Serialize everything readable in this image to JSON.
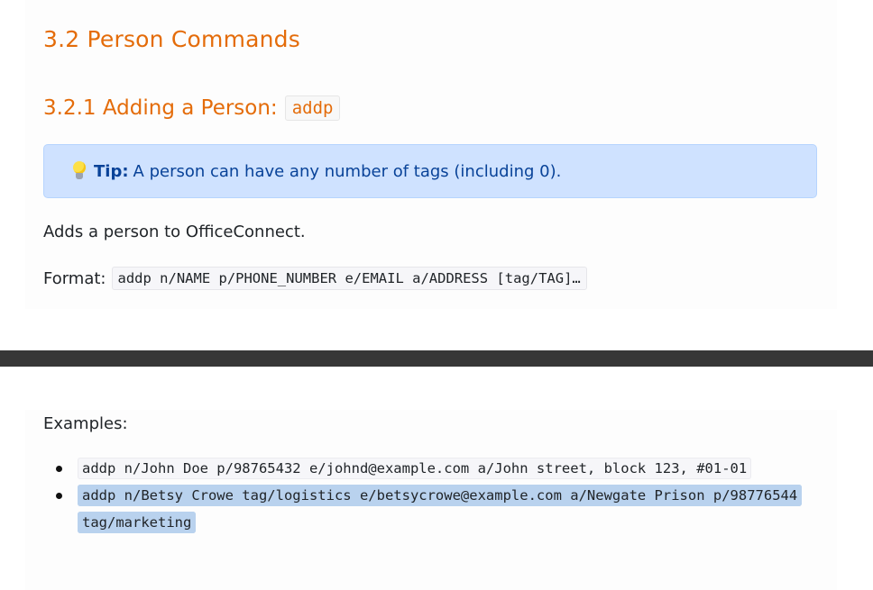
{
  "section": {
    "title": "3.2 Person Commands"
  },
  "subsection": {
    "title": "3.2.1 Adding a Person:",
    "command": "addp"
  },
  "tip": {
    "icon": "lightbulb-icon",
    "label": "Tip:",
    "text": "A person can have any number of tags (including 0)."
  },
  "description": "Adds a person to OfficeConnect.",
  "format": {
    "label": "Format:",
    "code": "addp n/NAME p/PHONE_NUMBER e/EMAIL a/ADDRESS [tag/TAG]…"
  },
  "examples": {
    "label": "Examples:",
    "items": [
      "addp n/John Doe p/98765432 e/johnd@example.com a/John street, block 123, #01-01",
      "addp n/Betsy Crowe tag/logistics e/betsycrowe@example.com a/Newgate Prison p/98776544 tag/marketing"
    ]
  },
  "colors": {
    "heading": "#e46c0a",
    "tip_background": "#cfe2ff",
    "divider": "#373737",
    "selection": "#b9d2ee"
  }
}
